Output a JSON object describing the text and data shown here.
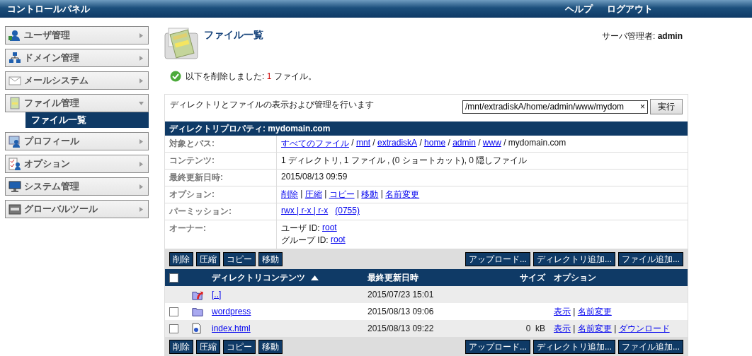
{
  "header": {
    "title": "コントロールパネル",
    "links": [
      "ヘルプ",
      "ログアウト"
    ]
  },
  "sidebar": {
    "items": [
      {
        "label": "ユーザ管理",
        "kind": "user",
        "expanded": false
      },
      {
        "label": "ドメイン管理",
        "kind": "network",
        "expanded": false
      },
      {
        "label": "メールシステム",
        "kind": "mail",
        "expanded": false
      },
      {
        "label": "ファイル管理",
        "kind": "file",
        "expanded": true,
        "children": [
          {
            "label": "ファイル一覧",
            "selected": true
          }
        ]
      },
      {
        "label": "プロフィール",
        "kind": "profile",
        "expanded": false
      },
      {
        "label": "オプション",
        "kind": "options",
        "expanded": false
      },
      {
        "label": "システム管理",
        "kind": "system",
        "expanded": false
      },
      {
        "label": "グローバルツール",
        "kind": "tools",
        "expanded": false
      }
    ]
  },
  "page": {
    "title": "ファイル一覧",
    "user_label": "サーバ管理者:",
    "user": "admin"
  },
  "message": {
    "parts": [
      {
        "text": "以下を削除しました: ",
        "emphasis": false
      },
      {
        "text": "1",
        "emphasis": true
      },
      {
        "text": " ファイル。",
        "emphasis": false
      }
    ]
  },
  "panel": {
    "description": "ディレクトリとファイルの表示および管理を行います",
    "path_field": {
      "value": "/mnt/extradiskA/home/admin/www/mydom"
    },
    "clear": "×",
    "run_button": "実行"
  },
  "properties": {
    "title": "ディレクトリプロパティ: mydomain.com",
    "rows": [
      {
        "label": "対象とパス:",
        "lines": [
          [
            {
              "text": "すべてのファイル",
              "link": true
            },
            {
              "text": " / ",
              "link": false
            },
            {
              "text": "mnt",
              "link": true
            },
            {
              "text": " / ",
              "link": false
            },
            {
              "text": "extradiskA",
              "link": true
            },
            {
              "text": " / ",
              "link": false
            },
            {
              "text": "home",
              "link": true
            },
            {
              "text": " / ",
              "link": false
            },
            {
              "text": "admin",
              "link": true
            },
            {
              "text": " / ",
              "link": false
            },
            {
              "text": "www",
              "link": true
            },
            {
              "text": " / mydomain.com",
              "link": false
            }
          ]
        ]
      },
      {
        "label": "コンテンツ:",
        "lines": [
          [
            {
              "text": "1 ディレクトリ, 1 ファイル , (0 ショートカット), 0 隠しファイル",
              "link": false
            }
          ]
        ]
      },
      {
        "label": "最終更新日時:",
        "lines": [
          [
            {
              "text": "2015/08/13 09:59",
              "link": false
            }
          ]
        ]
      },
      {
        "label": "オプション:",
        "lines": [
          [
            {
              "text": "削除",
              "link": true
            },
            {
              "text": " | ",
              "link": false
            },
            {
              "text": "圧縮",
              "link": true
            },
            {
              "text": " | ",
              "link": false
            },
            {
              "text": "コピー",
              "link": true
            },
            {
              "text": " | ",
              "link": false
            },
            {
              "text": "移動",
              "link": true
            },
            {
              "text": " | ",
              "link": false
            },
            {
              "text": "名前変更",
              "link": true
            }
          ]
        ]
      },
      {
        "label": "パーミッション:",
        "lines": [
          [
            {
              "text": "rwx | r-x | r-x",
              "link": true
            },
            {
              "text": "(0755)",
              "link": true
            }
          ]
        ]
      },
      {
        "label": "オーナー:",
        "lines": [
          [
            {
              "text": "ユーザ ID: ",
              "link": false
            },
            {
              "text": "root",
              "link": true
            }
          ],
          [
            {
              "text": "グループ ID: ",
              "link": false
            },
            {
              "text": "root",
              "link": true
            }
          ]
        ]
      }
    ]
  },
  "toolbar_top": {
    "left": [
      "削除",
      "圧縮",
      "コピー",
      "移動"
    ],
    "right": [
      "アップロード...",
      "ディレクトリ追加...",
      "ファイル追加..."
    ]
  },
  "table": {
    "select_all": {
      "checked": false
    },
    "columns": [
      {
        "label": "ディレクトリコンテンツ",
        "sorted": true
      },
      {
        "label": "最終更新日時",
        "sorted": false
      },
      {
        "label": "サイズ",
        "sorted": false
      },
      {
        "label": "オプション",
        "sorted": false
      }
    ],
    "rows": [
      {
        "kind": "parent",
        "name": "[..]",
        "date": "2015/07/23 15:01"
      },
      {
        "kind": "folder",
        "checked": false,
        "name": "wordpress",
        "date": "2015/08/13 09:06",
        "options": [
          {
            "text": "表示",
            "link": true
          },
          {
            "text": " | ",
            "link": false
          },
          {
            "text": "名前変更",
            "link": true
          }
        ]
      },
      {
        "kind": "file",
        "checked": false,
        "name": "index.html",
        "date": "2015/08/13 09:22",
        "size": "0  kB",
        "options": [
          {
            "text": "表示",
            "link": true
          },
          {
            "text": " | ",
            "link": false
          },
          {
            "text": "名前変更",
            "link": true
          },
          {
            "text": " | ",
            "link": false
          },
          {
            "text": "ダウンロード",
            "link": true
          }
        ]
      }
    ]
  },
  "toolbar_bottom": {
    "left": [
      "削除",
      "圧縮",
      "コピー",
      "移動"
    ],
    "right": [
      "アップロード...",
      "ディレクトリ追加...",
      "ファイル追加..."
    ]
  }
}
